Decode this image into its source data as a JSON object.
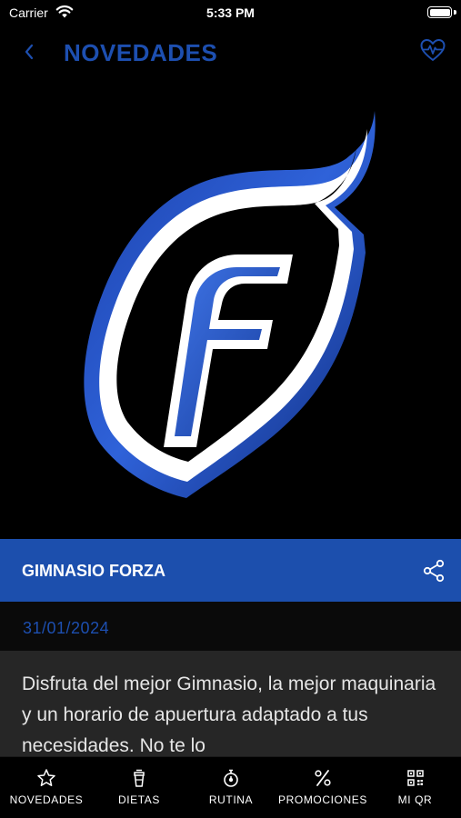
{
  "status_bar": {
    "carrier": "Carrier",
    "time": "5:33 PM"
  },
  "nav": {
    "title": "NOVEDADES"
  },
  "news": {
    "title": "GIMNASIO FORZA",
    "date": "31/01/2024",
    "body": "Disfruta del mejor Gimnasio, la mejor maquinaria y un horario de apuertura adaptado a tus necesidades. No te lo"
  },
  "tabs": [
    {
      "label": "NOVEDADES",
      "icon": "star-icon"
    },
    {
      "label": "DIETAS",
      "icon": "cup-icon"
    },
    {
      "label": "RUTINA",
      "icon": "stopwatch-icon"
    },
    {
      "label": "PROMOCIONES",
      "icon": "percent-icon"
    },
    {
      "label": "MI QR",
      "icon": "qr-code-icon"
    }
  ],
  "colors": {
    "accent": "#1c4fad",
    "background": "#000000",
    "body_box": "#262626"
  }
}
